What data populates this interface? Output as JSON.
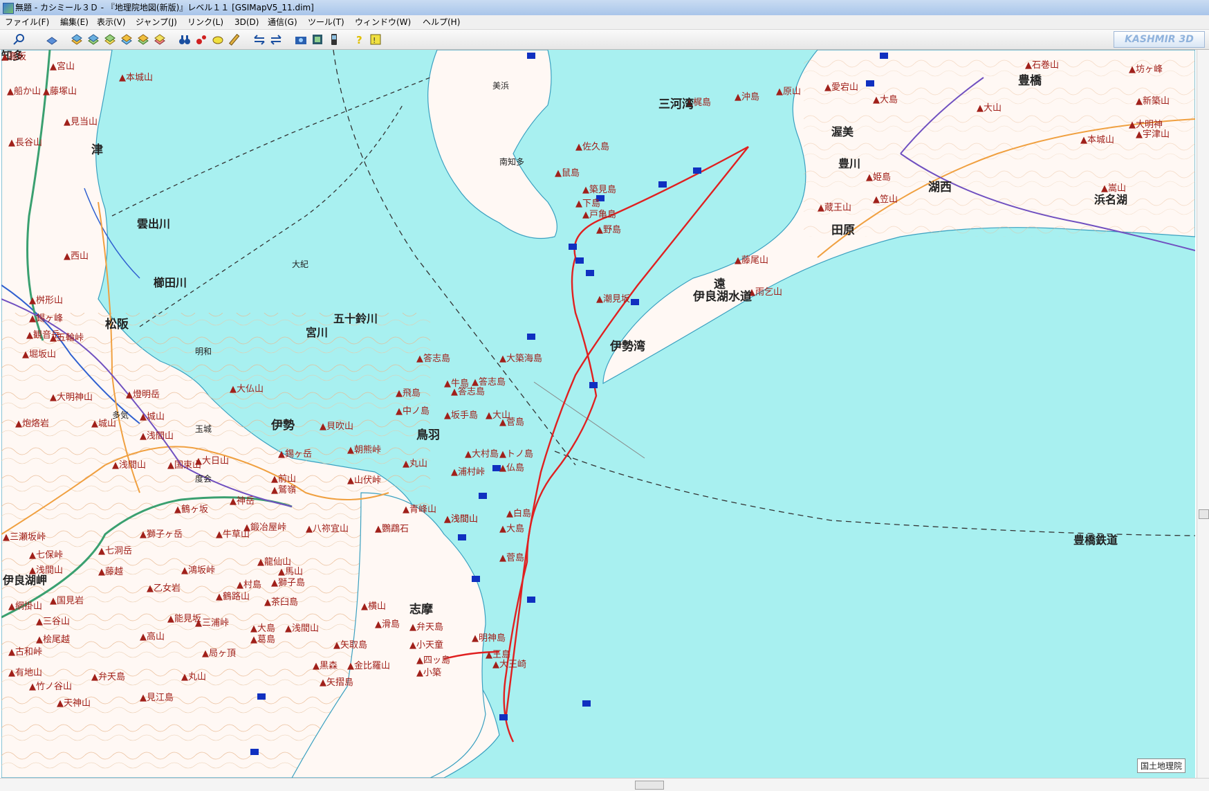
{
  "window": {
    "title": "無題 - カシミール３Ｄ - 『地理院地図(新版)』レベル１１ [GSIMapV5_11.dim]"
  },
  "menu": [
    {
      "label": "ファイル(F)"
    },
    {
      "label": "編集(E)"
    },
    {
      "label": "表示(V)"
    },
    {
      "label": "ジャンプ(J)"
    },
    {
      "label": "リンク(L)"
    },
    {
      "label": "3D(D)"
    },
    {
      "label": "通信(G)"
    },
    {
      "label": "ツール(T)"
    },
    {
      "label": "ウィンドウ(W)"
    },
    {
      "label": "ヘルプ(H)"
    }
  ],
  "toolbar": {
    "brand": "KASHMIR 3D",
    "icons": [
      "zoom-icon",
      "layer-icon",
      "map-stack-icon",
      "map-stack-icon",
      "map-stack-icon",
      "map-stack-icon",
      "map-stack-icon",
      "map-stack-icon",
      "binoculars-icon",
      "waypoint-icon",
      "route-icon",
      "ruler-icon",
      "arrow-left-icon",
      "arrow-right-icon",
      "camera-icon",
      "film-icon",
      "phone-icon",
      "help-icon",
      "about-icon"
    ]
  },
  "map": {
    "credit": "国土地理院",
    "labels": [
      {
        "t": "宮山",
        "c": "m"
      },
      {
        "t": "本城山",
        "c": "m"
      },
      {
        "t": "船か山",
        "c": "m"
      },
      {
        "t": "藤塚山",
        "c": "m"
      },
      {
        "t": "見当山",
        "c": "m"
      },
      {
        "t": "長谷山",
        "c": "m"
      },
      {
        "t": "津",
        "c": "city"
      },
      {
        "t": "雲出川",
        "c": "river"
      },
      {
        "t": "西山",
        "c": "m"
      },
      {
        "t": "櫛田川",
        "c": "river"
      },
      {
        "t": "桝形山",
        "c": "m"
      },
      {
        "t": "錫ヶ峰",
        "c": "m"
      },
      {
        "t": "観音岳",
        "c": "m"
      },
      {
        "t": "五輪峠",
        "c": "m"
      },
      {
        "t": "堀坂山",
        "c": "m"
      },
      {
        "t": "松阪",
        "c": "city"
      },
      {
        "t": "明和",
        "c": "town"
      },
      {
        "t": "宮川",
        "c": "river"
      },
      {
        "t": "五十鈴川",
        "c": "river"
      },
      {
        "t": "大明神山",
        "c": "m"
      },
      {
        "t": "燈明岳",
        "c": "m"
      },
      {
        "t": "大仏山",
        "c": "m"
      },
      {
        "t": "多気",
        "c": "town"
      },
      {
        "t": "城山",
        "c": "m"
      },
      {
        "t": "炮烙岩",
        "c": "m"
      },
      {
        "t": "城山",
        "c": "m"
      },
      {
        "t": "玉城",
        "c": "town"
      },
      {
        "t": "浅間山",
        "c": "m"
      },
      {
        "t": "伊勢",
        "c": "city"
      },
      {
        "t": "貝吹山",
        "c": "m"
      },
      {
        "t": "鳥羽",
        "c": "city"
      },
      {
        "t": "朝熊峠",
        "c": "m"
      },
      {
        "t": "錫ヶ岳",
        "c": "m"
      },
      {
        "t": "丸山",
        "c": "m"
      },
      {
        "t": "浅間山",
        "c": "m"
      },
      {
        "t": "国束山",
        "c": "m"
      },
      {
        "t": "大日山",
        "c": "m"
      },
      {
        "t": "度会",
        "c": "town"
      },
      {
        "t": "前山",
        "c": "m"
      },
      {
        "t": "鷲嶺",
        "c": "m"
      },
      {
        "t": "山伏峠",
        "c": "m"
      },
      {
        "t": "青峰山",
        "c": "m"
      },
      {
        "t": "神岳",
        "c": "m"
      },
      {
        "t": "鶴ヶ坂",
        "c": "m"
      },
      {
        "t": "獅子ヶ岳",
        "c": "m"
      },
      {
        "t": "牛草山",
        "c": "m"
      },
      {
        "t": "鍛冶屋峠",
        "c": "m"
      },
      {
        "t": "八祢宜山",
        "c": "m"
      },
      {
        "t": "鸚鵡石",
        "c": "m"
      },
      {
        "t": "浅間山",
        "c": "m"
      },
      {
        "t": "三瀬坂峠",
        "c": "m"
      },
      {
        "t": "七保峠",
        "c": "m"
      },
      {
        "t": "七洞岳",
        "c": "m"
      },
      {
        "t": "浅間山",
        "c": "m"
      },
      {
        "t": "藤越",
        "c": "m"
      },
      {
        "t": "鴻坂峠",
        "c": "m"
      },
      {
        "t": "龍仙山",
        "c": "m"
      },
      {
        "t": "乙女岩",
        "c": "m"
      },
      {
        "t": "馬山",
        "c": "m"
      },
      {
        "t": "村島",
        "c": "m"
      },
      {
        "t": "獅子島",
        "c": "m"
      },
      {
        "t": "網掛山",
        "c": "m"
      },
      {
        "t": "国見岩",
        "c": "m"
      },
      {
        "t": "鶴路山",
        "c": "m"
      },
      {
        "t": "茶臼島",
        "c": "m"
      },
      {
        "t": "横山",
        "c": "m"
      },
      {
        "t": "志摩",
        "c": "city"
      },
      {
        "t": "能見坂",
        "c": "m"
      },
      {
        "t": "三浦峠",
        "c": "m"
      },
      {
        "t": "三谷山",
        "c": "m"
      },
      {
        "t": "大島",
        "c": "m"
      },
      {
        "t": "浅間山",
        "c": "m"
      },
      {
        "t": "滑島",
        "c": "m"
      },
      {
        "t": "弁天島",
        "c": "m"
      },
      {
        "t": "桧尾越",
        "c": "m"
      },
      {
        "t": "高山",
        "c": "m"
      },
      {
        "t": "葛島",
        "c": "m"
      },
      {
        "t": "矢取島",
        "c": "m"
      },
      {
        "t": "小天童",
        "c": "m"
      },
      {
        "t": "古和峠",
        "c": "m"
      },
      {
        "t": "局ヶ頂",
        "c": "m"
      },
      {
        "t": "四ッ島",
        "c": "m"
      },
      {
        "t": "黒森",
        "c": "m"
      },
      {
        "t": "金比羅山",
        "c": "m"
      },
      {
        "t": "小築",
        "c": "m"
      },
      {
        "t": "有地山",
        "c": "m"
      },
      {
        "t": "弁天島",
        "c": "m"
      },
      {
        "t": "丸山",
        "c": "m"
      },
      {
        "t": "矢摺島",
        "c": "m"
      },
      {
        "t": "竹ノ谷山",
        "c": "m"
      },
      {
        "t": "天神山",
        "c": "m"
      },
      {
        "t": "見江島",
        "c": "m"
      },
      {
        "t": "答志島",
        "c": "m"
      },
      {
        "t": "大築海島",
        "c": "m"
      },
      {
        "t": "牛島",
        "c": "m"
      },
      {
        "t": "答志島",
        "c": "m"
      },
      {
        "t": "飛島",
        "c": "m"
      },
      {
        "t": "答志島",
        "c": "m"
      },
      {
        "t": "中ノ島",
        "c": "m"
      },
      {
        "t": "坂手島",
        "c": "m"
      },
      {
        "t": "大山",
        "c": "m"
      },
      {
        "t": "菅島",
        "c": "m"
      },
      {
        "t": "大村島",
        "c": "m"
      },
      {
        "t": "トノ島",
        "c": "m"
      },
      {
        "t": "仏島",
        "c": "m"
      },
      {
        "t": "浦村峠",
        "c": "m"
      },
      {
        "t": "白島",
        "c": "m"
      },
      {
        "t": "大島",
        "c": "m"
      },
      {
        "t": "浅間山",
        "c": "m"
      },
      {
        "t": "菅島",
        "c": "m"
      },
      {
        "t": "明神島",
        "c": "m"
      },
      {
        "t": "王島",
        "c": "m"
      },
      {
        "t": "大王崎",
        "c": "m"
      },
      {
        "t": "美浜",
        "c": "town"
      },
      {
        "t": "南知多",
        "c": "town"
      },
      {
        "t": "鼠島",
        "c": "m"
      },
      {
        "t": "築見島",
        "c": "m"
      },
      {
        "t": "下島",
        "c": "m"
      },
      {
        "t": "戸亀島",
        "c": "m"
      },
      {
        "t": "野島",
        "c": "m"
      },
      {
        "t": "佐久島",
        "c": "m"
      },
      {
        "t": "梶島",
        "c": "m"
      },
      {
        "t": "沖島",
        "c": "m"
      },
      {
        "t": "原山",
        "c": "m"
      },
      {
        "t": "愛宕山",
        "c": "m"
      },
      {
        "t": "大島",
        "c": "m"
      },
      {
        "t": "豊川",
        "c": "river"
      },
      {
        "t": "姫島",
        "c": "m"
      },
      {
        "t": "笠山",
        "c": "m"
      },
      {
        "t": "蔵王山",
        "c": "m"
      },
      {
        "t": "田原",
        "c": "city"
      },
      {
        "t": "藤尾山",
        "c": "m"
      },
      {
        "t": "雨乞山",
        "c": "m"
      },
      {
        "t": "大山",
        "c": "m"
      },
      {
        "t": "豊橋",
        "c": "city"
      },
      {
        "t": "石巻山",
        "c": "m"
      },
      {
        "t": "坊ヶ峰",
        "c": "m"
      },
      {
        "t": "新築山",
        "c": "m"
      },
      {
        "t": "大明神",
        "c": "m"
      },
      {
        "t": "本城山",
        "c": "m"
      },
      {
        "t": "宇津山",
        "c": "m"
      },
      {
        "t": "嵩山",
        "c": "m"
      },
      {
        "t": "浜名湖",
        "c": "river"
      },
      {
        "t": "湖西",
        "c": "city"
      },
      {
        "t": "潮見坂",
        "c": "m"
      },
      {
        "t": "豊橋鉄道",
        "c": "river"
      },
      {
        "t": "伊良湖岬",
        "c": "river"
      },
      {
        "t": "遠",
        "c": "sea"
      },
      {
        "t": "大紀",
        "c": "town"
      },
      {
        "t": "渥美",
        "c": "river"
      },
      {
        "t": "伊勢湾",
        "c": "sea"
      },
      {
        "t": "三河湾",
        "c": "sea"
      },
      {
        "t": "伊良湖水道",
        "c": "sea"
      },
      {
        "t": "知多",
        "c": "river"
      },
      {
        "t": "高坂",
        "c": "m"
      }
    ]
  }
}
